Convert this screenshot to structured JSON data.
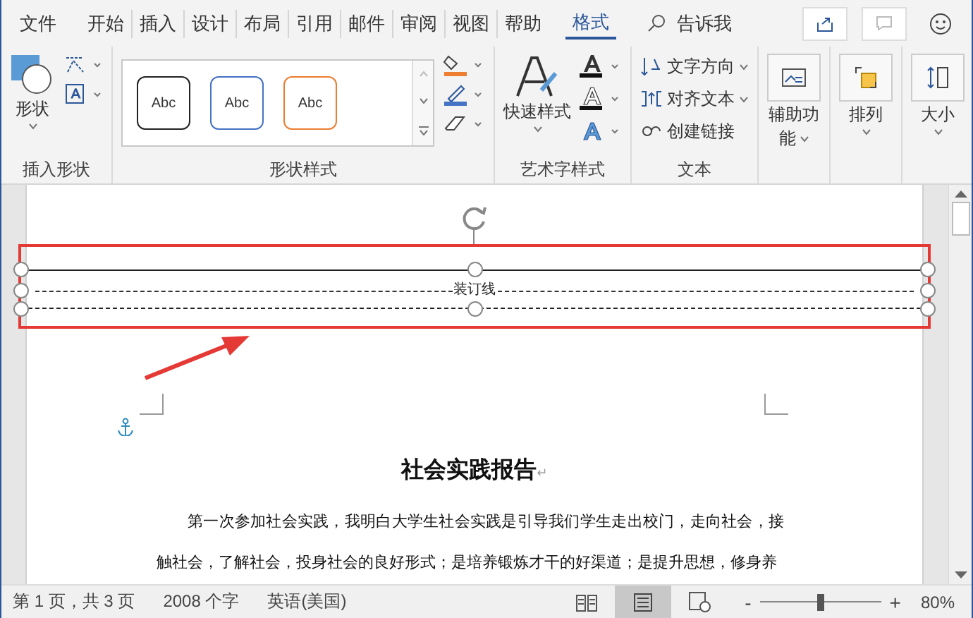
{
  "menu_tabs": [
    {
      "label": "文件",
      "selected": false
    },
    {
      "label": "开始",
      "selected": false
    },
    {
      "label": "插入",
      "selected": false
    },
    {
      "label": "设计",
      "selected": false
    },
    {
      "label": "布局",
      "selected": false
    },
    {
      "label": "引用",
      "selected": false
    },
    {
      "label": "邮件",
      "selected": false
    },
    {
      "label": "审阅",
      "selected": false
    },
    {
      "label": "视图",
      "selected": false
    },
    {
      "label": "帮助",
      "selected": false
    },
    {
      "label": "格式",
      "selected": true
    }
  ],
  "tell_me": "告诉我",
  "ribbon": {
    "insert_shapes": {
      "label": "插入形状",
      "shape_button": "形状"
    },
    "shape_styles": {
      "label": "形状样式",
      "gallery": [
        {
          "text": "Abc",
          "color": "#222222"
        },
        {
          "text": "Abc",
          "color": "#4472c4"
        },
        {
          "text": "Abc",
          "color": "#ed7d31"
        }
      ]
    },
    "wordart_styles": {
      "label": "艺术字样式",
      "quick_styles": "快速样式"
    },
    "text": {
      "label": "文本",
      "buttons": [
        "文字方向",
        "对齐文本",
        "创建链接"
      ]
    },
    "accessibility": {
      "label_line1": "辅助功",
      "label_line2": "能"
    },
    "arrange": "排列",
    "size": "大小"
  },
  "document": {
    "binding_line": "装订线",
    "title": "社会实践报告",
    "paragraph_mark": "↵",
    "paragraph": "第一次参加社会实践，我明白大学生社会实践是引导我们学生走出校门，走向社会，接触社会，了解社会，投身社会的良好形式；是培养锻炼才干的好渠道；是提升思想，修身养"
  },
  "status_bar": {
    "page": "第 1 页，共 3 页",
    "words": "2008 个字",
    "language": "英语(美国)",
    "views": [
      {
        "kind": "read",
        "selected": false
      },
      {
        "kind": "print",
        "selected": true
      },
      {
        "kind": "web",
        "selected": false
      }
    ],
    "zoom_out": "-",
    "zoom_in": "+",
    "zoom": {
      "level": 0.5
    },
    "zoom_text": "80%"
  }
}
